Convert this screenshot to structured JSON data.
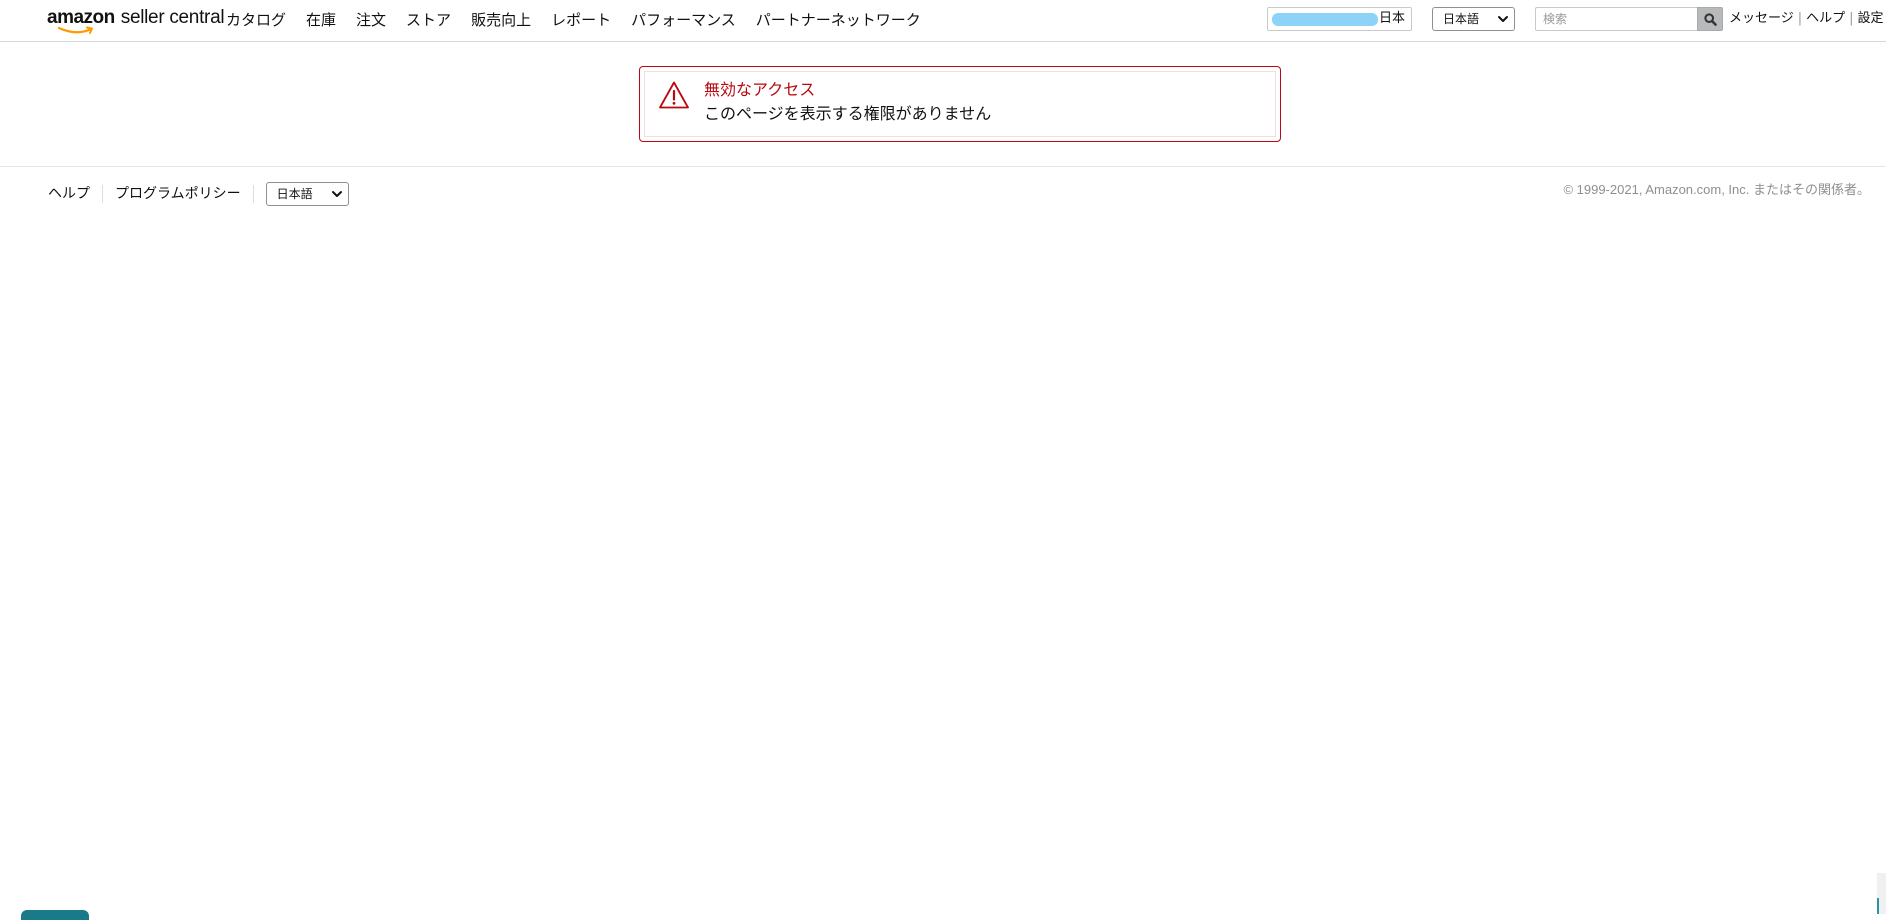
{
  "header": {
    "logo": {
      "brand": "amazon",
      "product": "seller central"
    },
    "nav_items": [
      {
        "label": "カタログ"
      },
      {
        "label": "在庫"
      },
      {
        "label": "注文"
      },
      {
        "label": "ストア"
      },
      {
        "label": "販売向上"
      },
      {
        "label": "レポート"
      },
      {
        "label": "パフォーマンス"
      },
      {
        "label": "パートナーネットワーク"
      }
    ],
    "marketplace": {
      "country": "日本"
    },
    "language_select": {
      "selected": "日本語"
    },
    "search": {
      "placeholder": "検索",
      "value": ""
    },
    "links": {
      "messages": "メッセージ",
      "help": "ヘルプ",
      "settings": "設定",
      "separator": "|"
    }
  },
  "alert": {
    "title": "無効なアクセス",
    "message": "このページを表示する権限がありません"
  },
  "footer": {
    "help": "ヘルプ",
    "program_policy": "プログラムポリシー",
    "language_select": {
      "selected": "日本語"
    },
    "copyright": "© 1999-2021, Amazon.com, Inc. またはその関係者。"
  },
  "colors": {
    "alert_border": "#b7090f",
    "alert_title": "#b7090f",
    "logo_smile": "#ff9900",
    "search_button": "#b7b9bb",
    "bottom_tab": "#1b7a89"
  },
  "icons": {
    "alert": "warning-triangle-icon",
    "search": "magnifier-icon",
    "select": "chevron-down-icon",
    "logo": "amazon-smile-icon"
  }
}
